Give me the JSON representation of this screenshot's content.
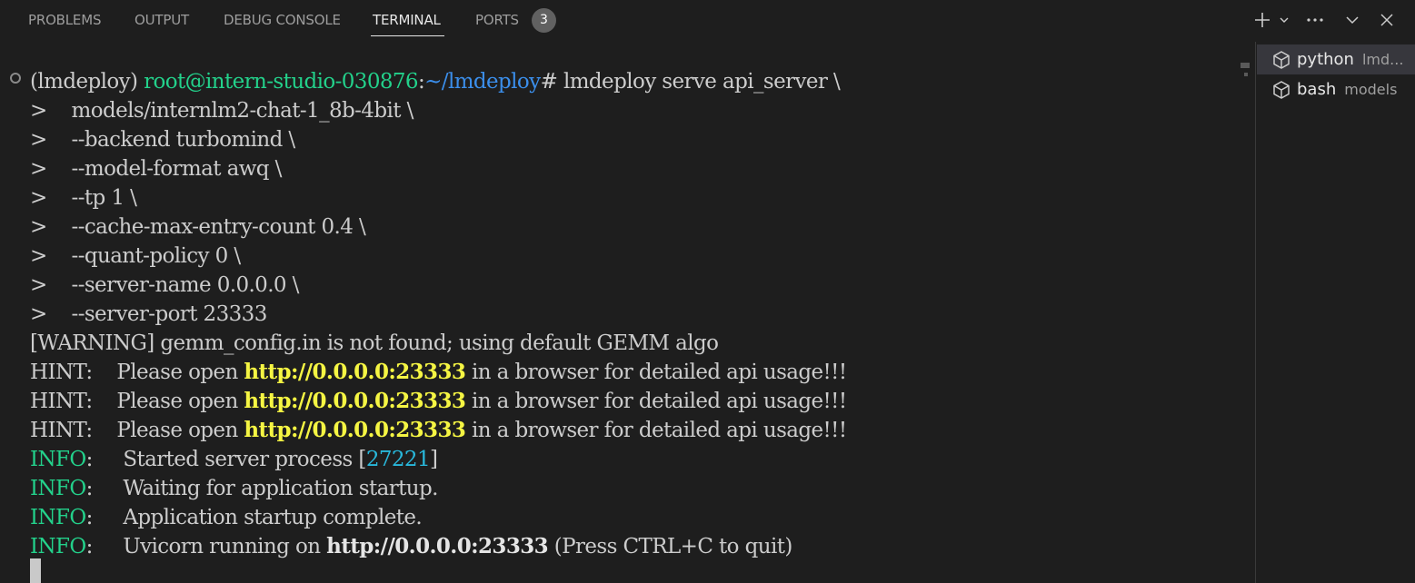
{
  "tabs": [
    {
      "label": "PROBLEMS"
    },
    {
      "label": "OUTPUT"
    },
    {
      "label": "DEBUG CONSOLE"
    },
    {
      "label": "TERMINAL"
    },
    {
      "label": "PORTS"
    }
  ],
  "ports_badge": "3",
  "active_tab": "TERMINAL",
  "icons": {
    "new_terminal": "plus-icon",
    "dropdown": "chevron-down-icon",
    "more": "ellipsis-icon",
    "collapse": "chevron-down-icon",
    "close": "close-icon",
    "terminal_instance": "terminal-icon"
  },
  "colors": {
    "background": "#1e1e1e",
    "green": "#23d18b",
    "blue": "#3b8eea",
    "yellow": "#f5f543",
    "cyan": "#29b8db"
  },
  "terminal": {
    "prompt": {
      "env": "(lmdeploy) ",
      "user_host": "root@intern-studio-030876",
      "sep": ":",
      "path": "~/lmdeploy",
      "symbol": "# ",
      "command": "lmdeploy serve api_server \\"
    },
    "continuations": [
      {
        "marker": ">",
        "text": "    models/internlm2-chat-1_8b-4bit \\"
      },
      {
        "marker": ">",
        "text": "    --backend turbomind \\"
      },
      {
        "marker": ">",
        "text": "    --model-format awq \\"
      },
      {
        "marker": ">",
        "text": "    --tp 1 \\"
      },
      {
        "marker": ">",
        "text": "    --cache-max-entry-count 0.4 \\"
      },
      {
        "marker": ">",
        "text": "    --quant-policy 0 \\"
      },
      {
        "marker": ">",
        "text": "    --server-name 0.0.0.0 \\"
      },
      {
        "marker": ">",
        "text": "    --server-port 23333"
      }
    ],
    "warning": "[WARNING] gemm_config.in is not found; using default GEMM algo",
    "hints": [
      {
        "prefix": "HINT:    Please open ",
        "url": "http://0.0.0.0:23333",
        "suffix": " in a browser for detailed api usage!!!"
      },
      {
        "prefix": "HINT:    Please open ",
        "url": "http://0.0.0.0:23333",
        "suffix": " in a browser for detailed api usage!!!"
      },
      {
        "prefix": "HINT:    Please open ",
        "url": "http://0.0.0.0:23333",
        "suffix": " in a browser for detailed api usage!!!"
      }
    ],
    "info1": {
      "level": "INFO",
      "sep": ":     ",
      "text": "Started server process [",
      "pid": "27221",
      "end": "]"
    },
    "info2": {
      "level": "INFO",
      "sep": ":     ",
      "text": "Waiting for application startup."
    },
    "info3": {
      "level": "INFO",
      "sep": ":     ",
      "text": "Application startup complete."
    },
    "info4": {
      "level": "INFO",
      "sep": ":     ",
      "text": "Uvicorn running on ",
      "url": "http://0.0.0.0:23333",
      "end": " (Press CTRL+C to quit)"
    }
  },
  "side": {
    "items": [
      {
        "name": "python",
        "desc": "lmd..."
      },
      {
        "name": "bash",
        "desc": "models"
      }
    ]
  }
}
